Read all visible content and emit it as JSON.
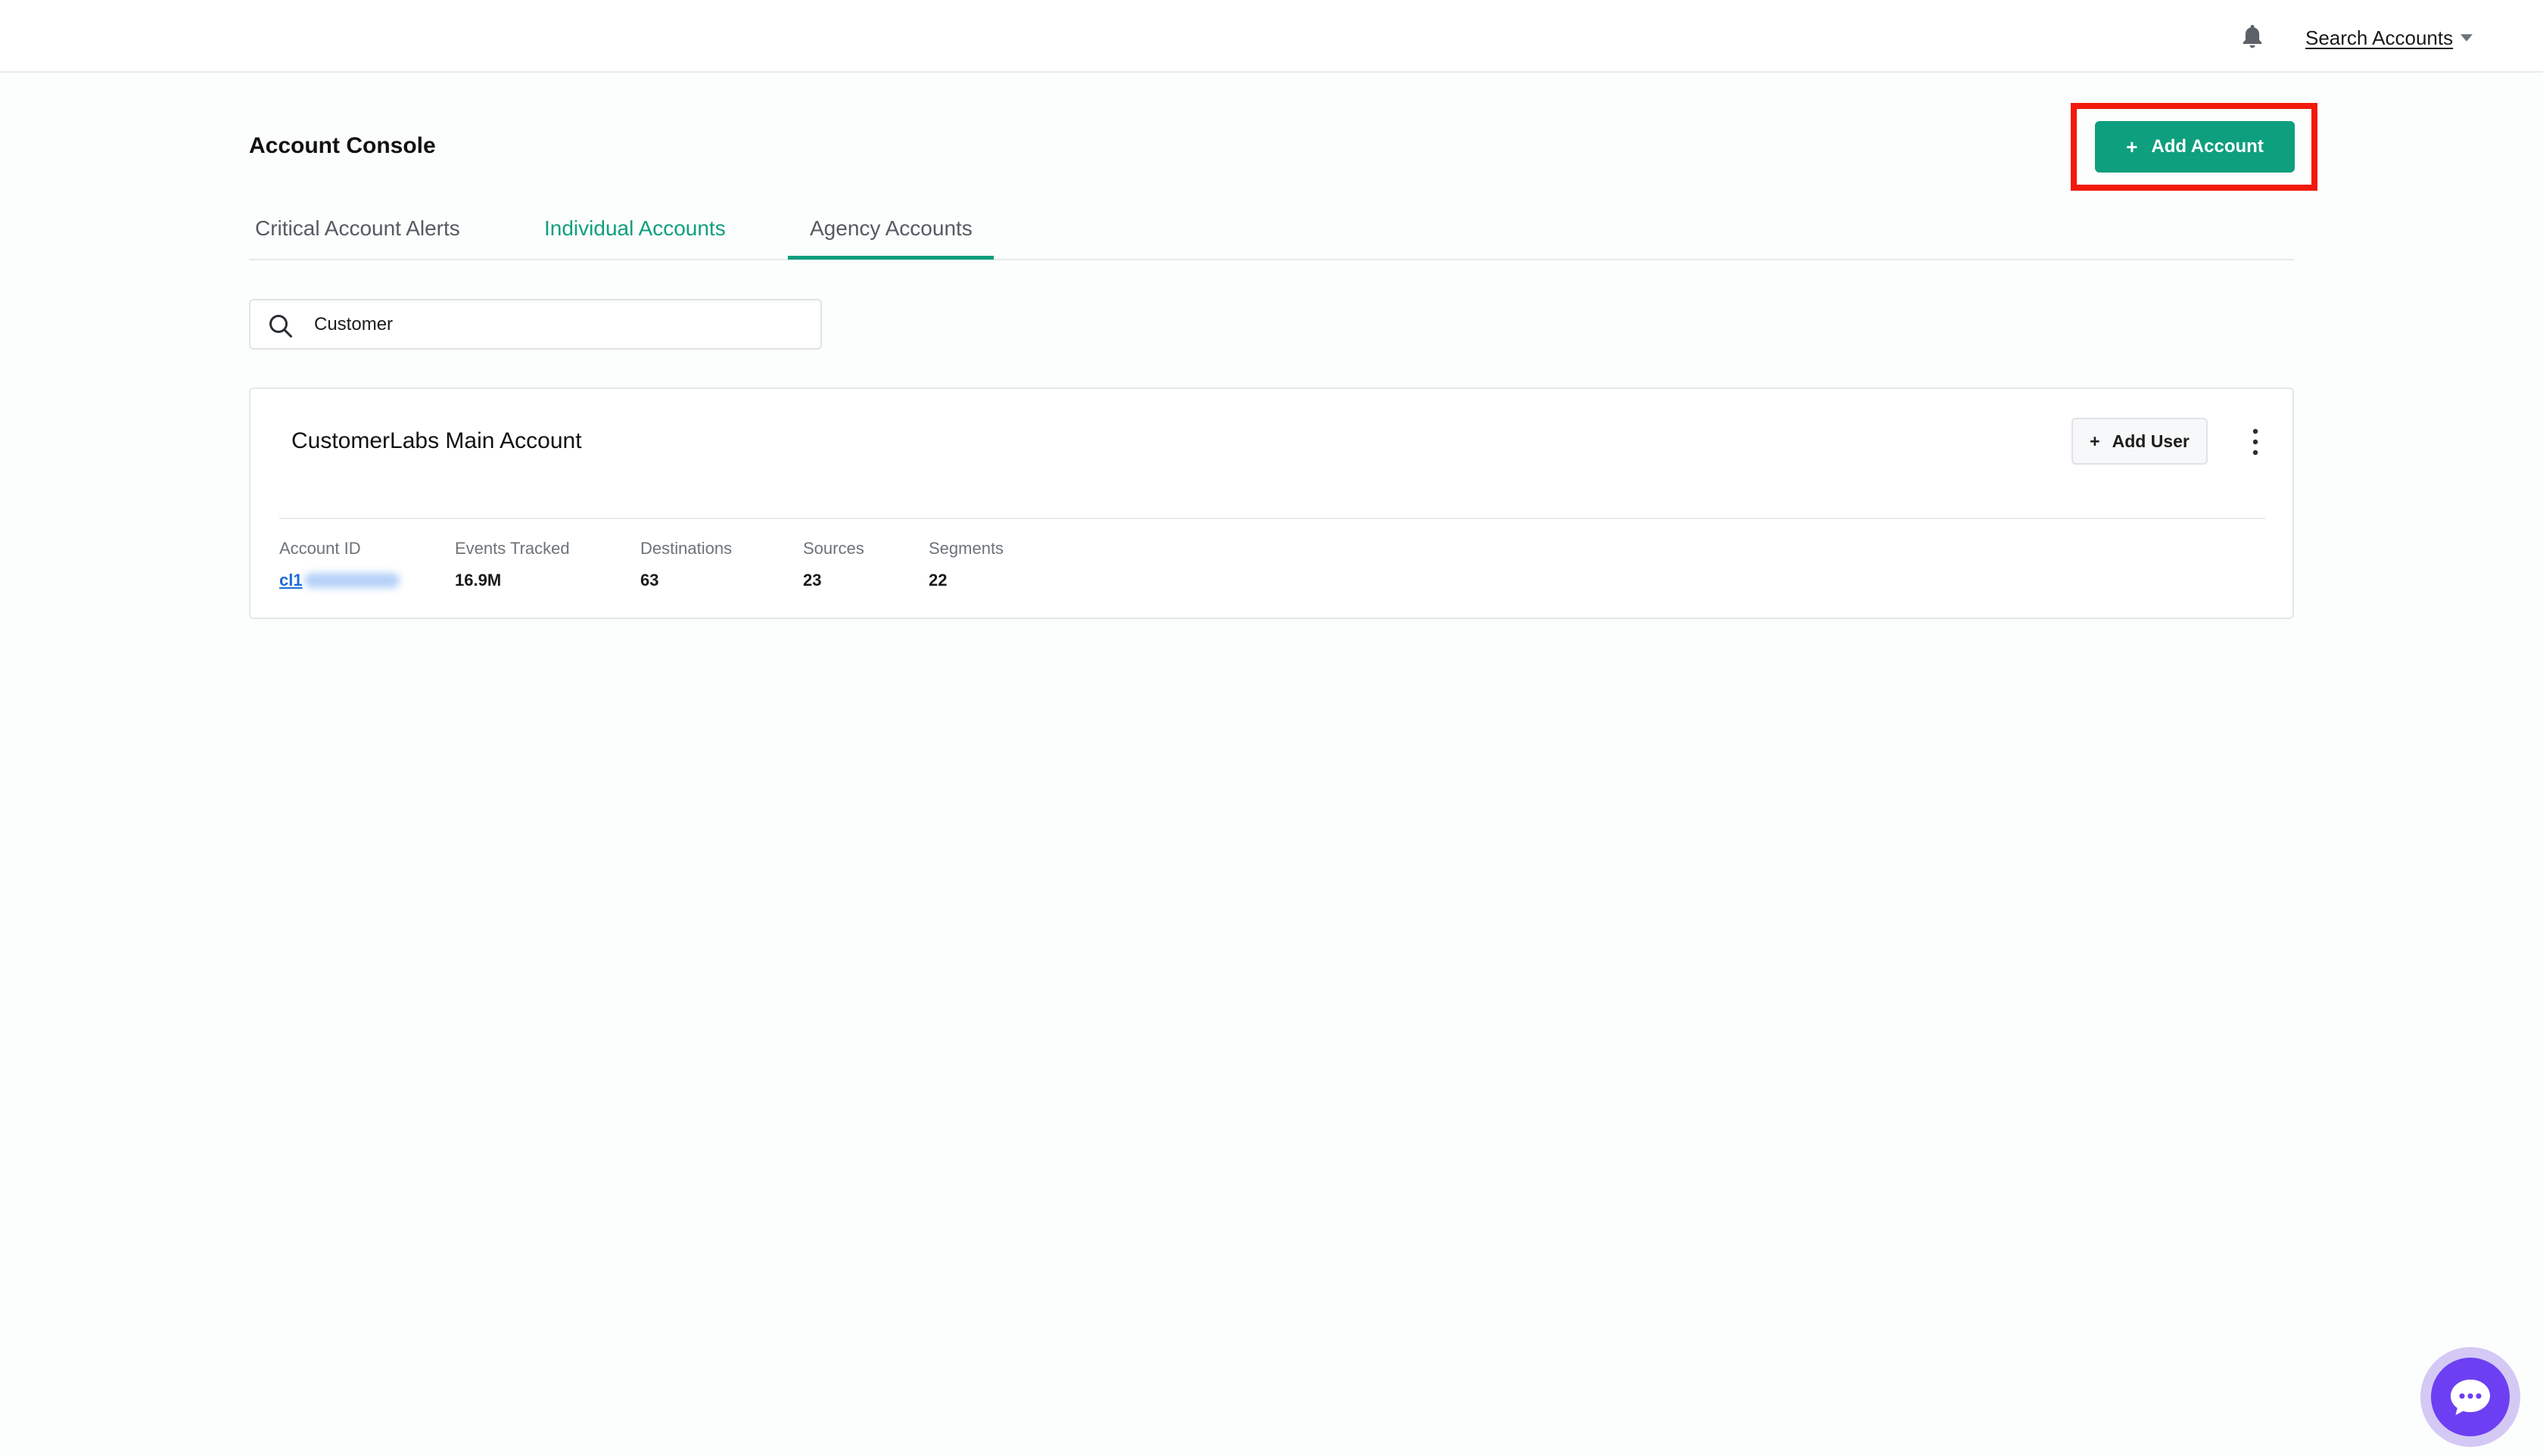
{
  "topbar": {
    "account_switcher_label": "Search Accounts",
    "icons": [
      "bell-icon",
      "chevron-down-icon"
    ]
  },
  "page": {
    "title": "Account Console",
    "add_account_label": "Add Account",
    "accent_color": "#0e9f7e",
    "highlight_color": "#f11a0c"
  },
  "tabs": [
    {
      "label": "Critical Account Alerts",
      "active": false
    },
    {
      "label": "Individual Accounts",
      "active": true
    },
    {
      "label": "Agency Accounts",
      "active": false
    }
  ],
  "search": {
    "value": "Customer"
  },
  "account_card": {
    "name": "CustomerLabs Main Account",
    "add_user_label": "Add User",
    "stats": [
      {
        "label": "Account ID",
        "value": "cl1"
      },
      {
        "label": "Events Tracked",
        "value": "16.9M"
      },
      {
        "label": "Destinations",
        "value": "63"
      },
      {
        "label": "Sources",
        "value": "23"
      },
      {
        "label": "Segments",
        "value": "22"
      }
    ]
  },
  "chat_widget": {
    "icon": "chat-bubble-icon",
    "color": "#6d3ff2"
  }
}
